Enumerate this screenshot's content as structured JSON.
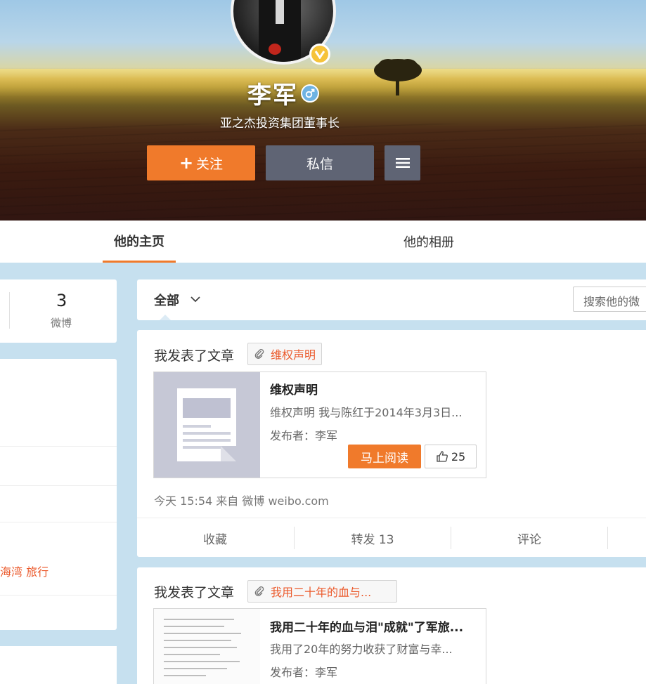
{
  "profile": {
    "name": "李军",
    "title": "亚之杰投资集团董事长",
    "follow_label": "关注",
    "message_label": "私信"
  },
  "tabs": {
    "home": "他的主页",
    "album": "他的相册"
  },
  "stats": {
    "weibo_count": "3",
    "weibo_label": "微博"
  },
  "sidebar": {
    "tags": "海湾 旅行"
  },
  "feed": {
    "filter_label": "全部",
    "search_placeholder": "搜索他的微",
    "posts": [
      {
        "header": "我发表了文章",
        "tag": "维权声明",
        "article_title": "维权声明",
        "article_desc": "维权声明 我与陈红于2014年3月3日...",
        "article_publisher": "发布者：李军",
        "read_label": "马上阅读",
        "likes": "25",
        "meta": "今天 15:54 来自 微博 weibo.com",
        "actions": {
          "fav": "收藏",
          "repost": "转发 13",
          "comment": "评论"
        }
      },
      {
        "header": "我发表了文章",
        "tag": "我用二十年的血与...",
        "article_title": "我用二十年的血与泪\"成就\"了军旅...",
        "article_desc": "我用了20年的努力收获了财富与幸...",
        "article_publisher": "发布者：李军"
      }
    ]
  },
  "colors": {
    "accent": "#f07a2b",
    "secondary_button": "#5f6474",
    "tag_text": "#eb5a2c"
  },
  "icons": [
    "plus-icon",
    "menu-icon",
    "verified-badge-icon",
    "gender-male-icon",
    "chevron-down-icon",
    "paperclip-icon",
    "thumbs-up-icon",
    "document-icon"
  ]
}
